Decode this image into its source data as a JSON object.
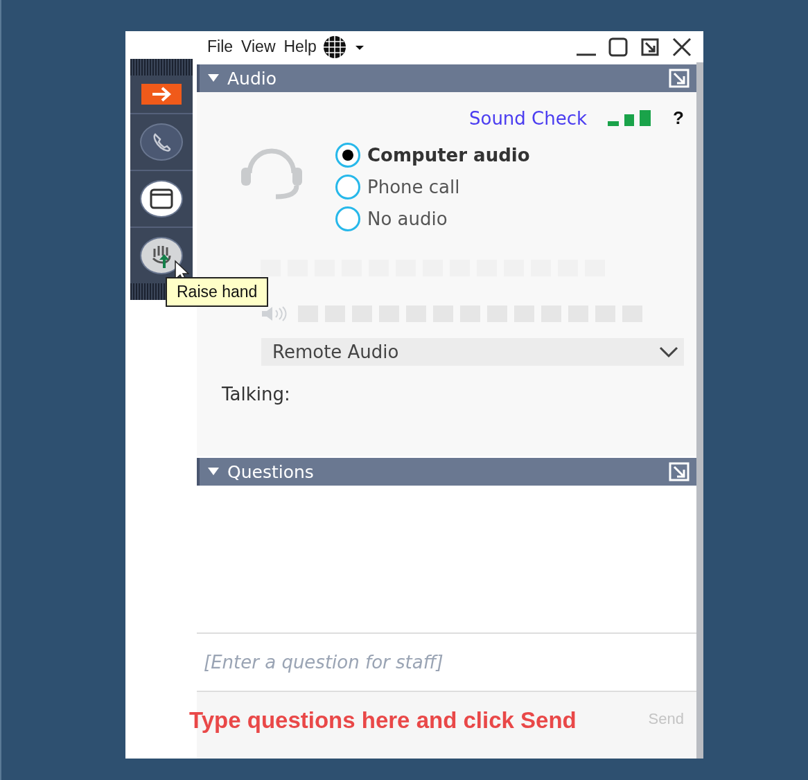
{
  "menu": [
    "File",
    "View",
    "Help"
  ],
  "tooltip": "Raise hand",
  "audio": {
    "title": "Audio",
    "expanded": true,
    "sound_check": "Sound Check",
    "help": "?",
    "options": [
      {
        "label": "Computer audio",
        "selected": true
      },
      {
        "label": "Phone call",
        "selected": false
      },
      {
        "label": "No audio",
        "selected": false
      }
    ],
    "output_device": "Remote Audio",
    "talking_label": "Talking:"
  },
  "questions": {
    "title": "Questions",
    "expanded": true,
    "placeholder": "[Enter a question for staff]",
    "send_button": {
      "label": "Send",
      "disabled": true
    }
  },
  "annotation": "Type questions here and click Send"
}
